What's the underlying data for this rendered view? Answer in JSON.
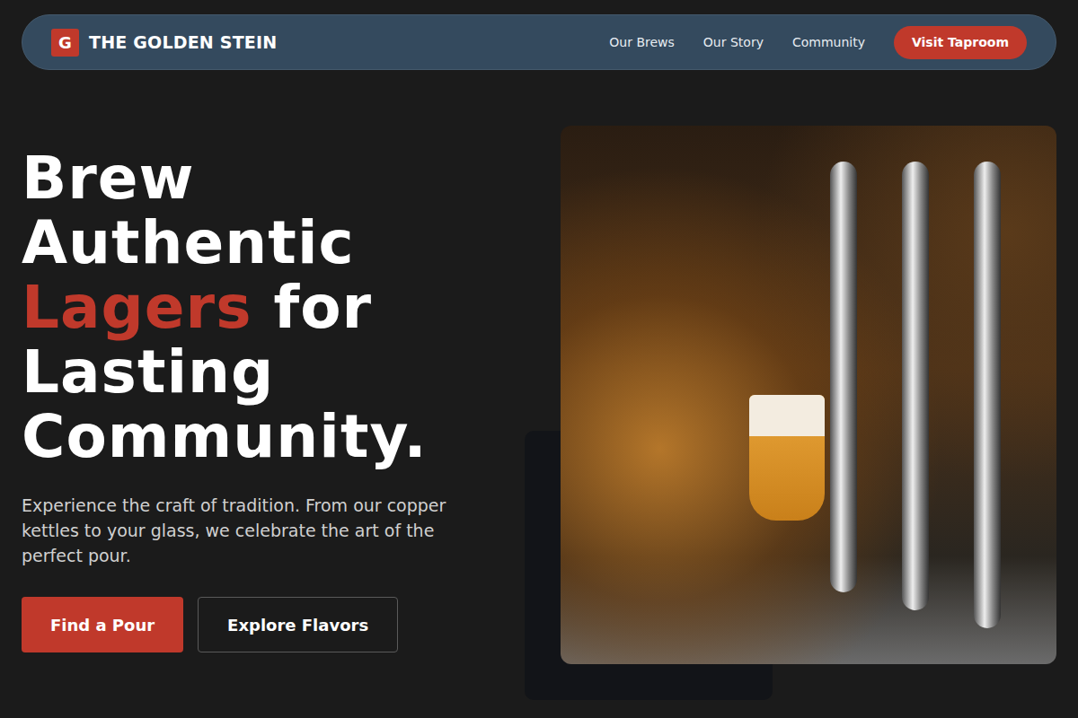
{
  "nav": {
    "logo_letter": "G",
    "brand": "THE GOLDEN STEIN",
    "links": [
      {
        "label": "Our Brews"
      },
      {
        "label": "Our Story"
      },
      {
        "label": "Community"
      }
    ],
    "cta": "Visit Taproom"
  },
  "hero": {
    "headline": [
      [
        {
          "text": "Brew",
          "accent": false
        }
      ],
      [
        {
          "text": "Authentic",
          "accent": false
        }
      ],
      [
        {
          "text": "Lagers",
          "accent": true
        },
        {
          "text": " for",
          "accent": false
        }
      ],
      [
        {
          "text": "Lasting",
          "accent": false
        }
      ],
      [
        {
          "text": "Community.",
          "accent": false
        }
      ]
    ],
    "description": "Experience the craft of tradition. From our copper kettles to your glass, we celebrate the art of the perfect pour.",
    "buttons": [
      {
        "label": "Find a Pour",
        "kind": "primary"
      },
      {
        "label": "Explore Flavors",
        "kind": "outline"
      }
    ]
  }
}
